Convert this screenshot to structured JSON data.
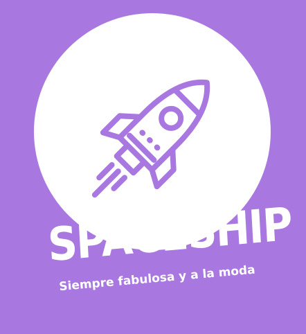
{
  "brand": {
    "name": "SPACESHIP",
    "tagline": "Siempre fabulosa y a la moda"
  },
  "colors": {
    "background": "#a877e0",
    "circle": "#ffffff",
    "rocket_stroke": "#a877e0",
    "text": "#ffffff"
  },
  "icons": {
    "main": "rocket-icon"
  }
}
